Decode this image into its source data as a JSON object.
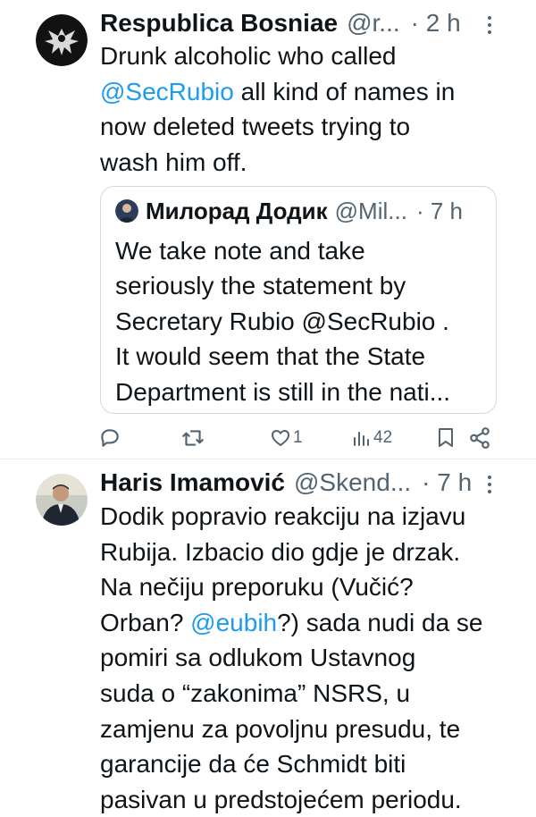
{
  "tweets": [
    {
      "name": "Respublica Bosniae",
      "handle": "@r...",
      "time": "· 2 h",
      "lines": [
        [
          {
            "t": "Drunk alcoholic who called"
          }
        ],
        [
          {
            "t": "@SecRubio",
            "m": true
          },
          {
            "t": " all kind of names in"
          }
        ],
        [
          {
            "t": "now deleted tweets trying to"
          }
        ],
        [
          {
            "t": "wash him off."
          }
        ]
      ],
      "quote": {
        "name": "Милорад Додик",
        "handle": "@Mil...",
        "time": "· 7 h",
        "lines": [
          "We take note and take",
          "seriously the statement by",
          "Secretary Rubio @SecRubio .",
          "It would seem that the State",
          "Department is still in the nati..."
        ]
      },
      "actions": {
        "reply_icon": "reply-icon",
        "retweet_icon": "retweet-icon",
        "like_icon": "heart-icon",
        "like_count": "1",
        "views_icon": "views-icon",
        "views_count": "42",
        "bookmark_icon": "bookmark-icon",
        "share_icon": "share-icon"
      }
    },
    {
      "name": "Haris Imamović",
      "handle": "@Skend...",
      "time": "· 7 h",
      "lines": [
        [
          {
            "t": "Dodik popravio reakciju na izjavu"
          }
        ],
        [
          {
            "t": "Rubija. Izbacio dio gdje je drzak."
          }
        ],
        [
          {
            "t": "Na nečiju preporuku (Vučić?"
          }
        ],
        [
          {
            "t": "Orban? "
          },
          {
            "t": "@eubih",
            "m": true
          },
          {
            "t": "?) sada nudi da se"
          }
        ],
        [
          {
            "t": "pomiri sa odlukom Ustavnog"
          }
        ],
        [
          {
            "t": "suda o “zakonima” NSRS, u"
          }
        ],
        [
          {
            "t": "zamjenu za povoljnu presudu, te"
          }
        ],
        [
          {
            "t": "garancije da će Schmidt biti"
          }
        ],
        [
          {
            "t": "pasivan u predstojećem periodu."
          }
        ]
      ]
    }
  ],
  "colors": {
    "text": "#0f1419",
    "secondary": "#536471",
    "mention": "#1d9bf0",
    "border": "#cfd9de"
  }
}
